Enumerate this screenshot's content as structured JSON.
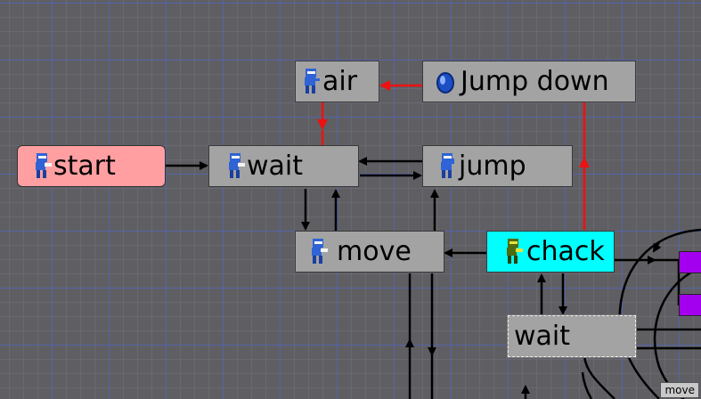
{
  "colors": {
    "canvas": "#5f5f63",
    "node_default": "#a3a3a3",
    "node_start": "#ff9fa2",
    "node_active": "#00ffff",
    "link_red": "#ee1111",
    "link_black": "#000000",
    "side_box": "#a400f0"
  },
  "nodes": {
    "air": {
      "label": "air",
      "icon": "ninja-icon"
    },
    "jump_down": {
      "label": "Jump down",
      "icon": "blue-gem-icon"
    },
    "start": {
      "label": "start",
      "icon": "ninja-icon"
    },
    "wait": {
      "label": "wait",
      "icon": "ninja-icon"
    },
    "jump": {
      "label": "jump",
      "icon": "ninja-icon"
    },
    "move": {
      "label": "move",
      "icon": "ninja-icon"
    },
    "chack": {
      "label": "chack",
      "icon": "green-ninja-icon"
    },
    "wait2": {
      "label": "wait",
      "icon": ""
    }
  },
  "corner_tag": "move"
}
